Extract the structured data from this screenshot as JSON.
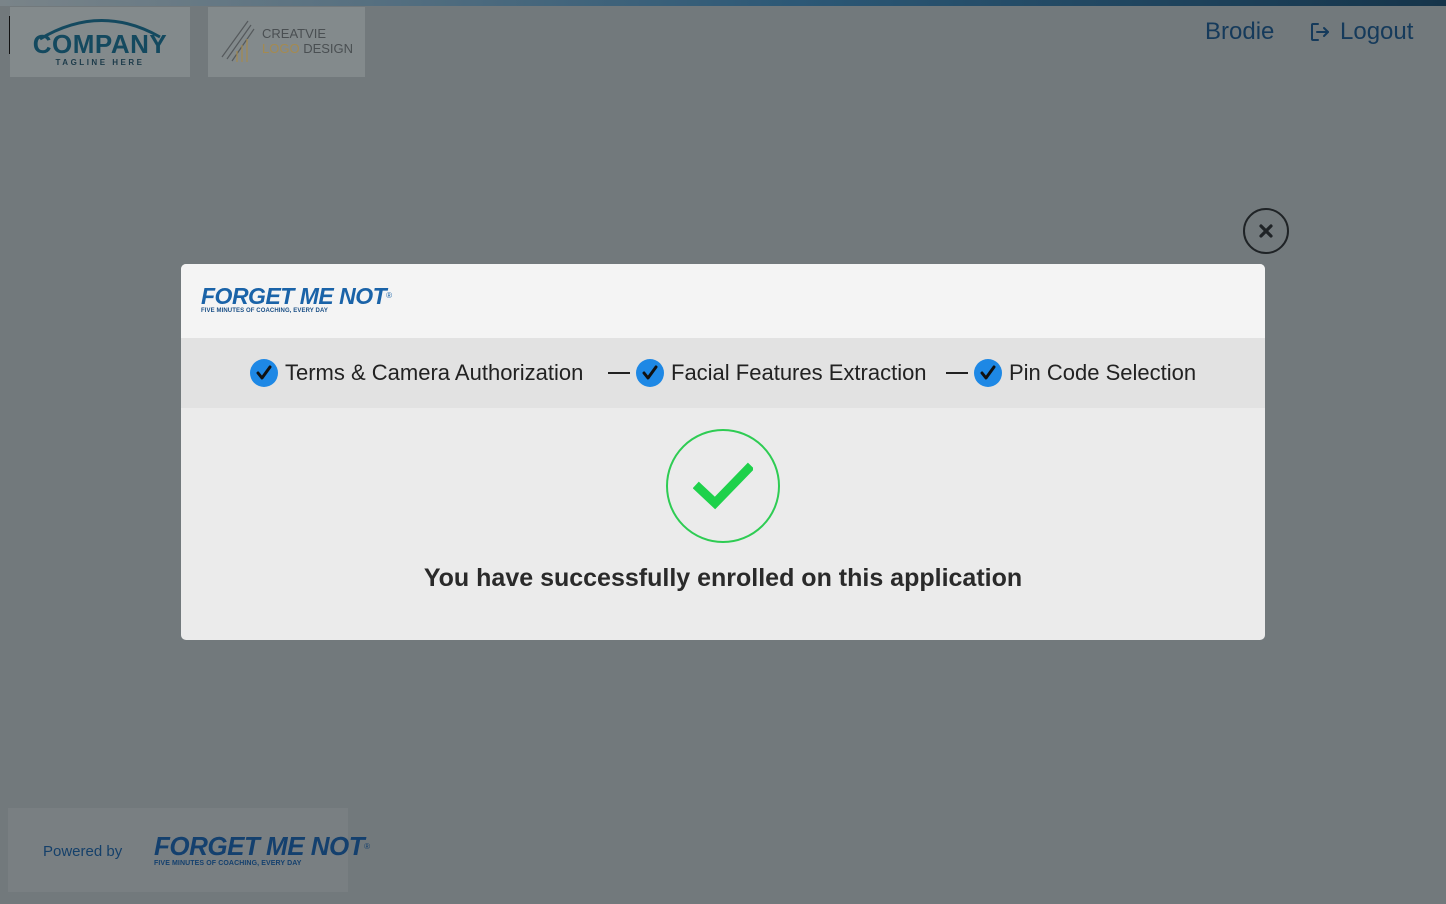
{
  "header": {
    "company_logo": {
      "name": "COMPANY",
      "tagline": "TAGLINE HERE"
    },
    "creative_logo": {
      "line1": "CREATVIE",
      "line2_part1": "LOGO",
      "line2_part2": " DESIGN"
    },
    "user_name": "Brodie",
    "logout_label": "Logout",
    "logout_icon": "logout-icon"
  },
  "modal": {
    "brand": {
      "name": "FORGET ME NOT",
      "tagline": "FIVE MINUTES OF COACHING, EVERY DAY"
    },
    "steps": [
      {
        "label": "Terms & Camera Authorization",
        "status": "complete"
      },
      {
        "label": "Facial Features Extraction",
        "status": "complete"
      },
      {
        "label": "Pin Code Selection",
        "status": "complete"
      }
    ],
    "success_message": "You have successfully enrolled on this application",
    "close_icon": "close-icon",
    "success_icon": "checkmark-icon"
  },
  "footer": {
    "powered_by": "Powered by",
    "brand": {
      "name": "FORGET ME NOT",
      "tagline": "FIVE MINUTES OF COACHING, EVERY DAY"
    }
  },
  "colors": {
    "overlay": "#72797c",
    "brand_blue": "#1a63a8",
    "nav_text": "#153a5b",
    "step_check": "#1e88e5",
    "success_green": "#2ecc53"
  }
}
